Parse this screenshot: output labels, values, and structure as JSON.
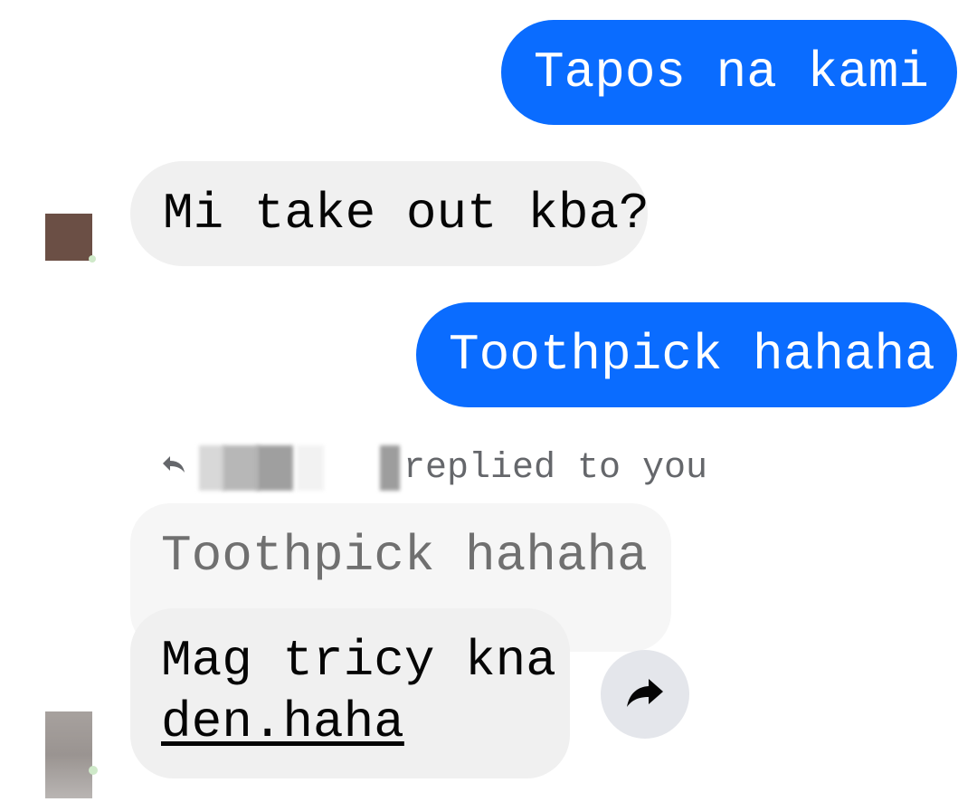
{
  "messages": [
    {
      "direction": "outgoing",
      "text": "Tapos na kami"
    },
    {
      "direction": "incoming",
      "text": "Mi take out kba?"
    },
    {
      "direction": "outgoing",
      "text": "Toothpick hahaha"
    }
  ],
  "reply": {
    "label": "replied to you",
    "quoted_text": "Toothpick hahaha",
    "message_line1": "Mag tricy kna",
    "message_line2": "den.haha"
  },
  "icons": {
    "reply_indicator": "reply-arrow-icon",
    "forward": "forward-icon"
  },
  "colors": {
    "outgoing_bubble": "#0a6cff",
    "incoming_bubble": "#f0f0f0",
    "quoted_bubble": "#f6f6f6",
    "forward_button": "#e4e6eb",
    "secondary_text": "#65676b"
  }
}
